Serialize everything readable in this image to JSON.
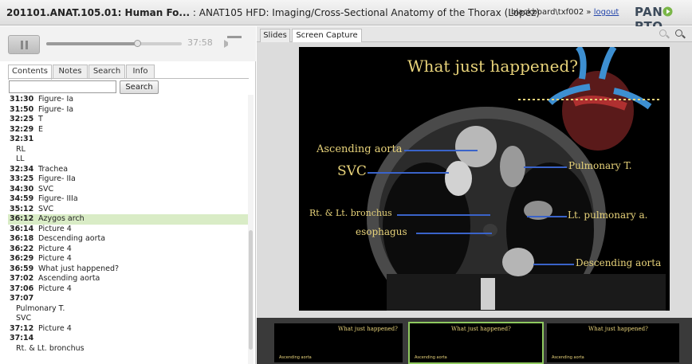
{
  "header": {
    "course_bold": "201101.ANAT.105.01: Human Fo...",
    "course_rest": " : ANAT105 HFD: Imaging/Cross-Sectional Anatomy of the Thorax (Lopez)",
    "user": "blackboard\\txf002 » ",
    "logout": "logout",
    "logo": "PANOPTO"
  },
  "player": {
    "time": "37:58",
    "progress": 0.67
  },
  "left_tabs": [
    "Contents",
    "Notes",
    "Search",
    "Info"
  ],
  "search": {
    "button": "Search",
    "value": ""
  },
  "contents": [
    {
      "time": "31:30",
      "title": "Figure- Ia"
    },
    {
      "time": "31:50",
      "title": "Figure- Ia"
    },
    {
      "time": "32:25",
      "title": "T"
    },
    {
      "time": "32:29",
      "title": "E"
    },
    {
      "time": "32:31",
      "title": "",
      "lines": [
        "RL",
        "LL"
      ]
    },
    {
      "time": "32:34",
      "title": "Trachea"
    },
    {
      "time": "33:25",
      "title": "Figure- IIa"
    },
    {
      "time": "34:30",
      "title": "SVC"
    },
    {
      "time": "34:59",
      "title": "Figure- IIIa"
    },
    {
      "time": "35:12",
      "title": "SVC"
    },
    {
      "time": "36:12",
      "title": "Azygos arch",
      "selected": true
    },
    {
      "time": "36:14",
      "title": "Picture 4"
    },
    {
      "time": "36:18",
      "title": "Descending aorta"
    },
    {
      "time": "36:22",
      "title": "Picture 4"
    },
    {
      "time": "36:29",
      "title": "Picture 4"
    },
    {
      "time": "36:59",
      "title": "What just happened?"
    },
    {
      "time": "37:02",
      "title": "Ascending aorta"
    },
    {
      "time": "37:06",
      "title": "Picture 4"
    },
    {
      "time": "37:07",
      "title": "",
      "lines": [
        "Pulmonary T.",
        "SVC"
      ]
    },
    {
      "time": "37:12",
      "title": "Picture 4"
    },
    {
      "time": "37:14",
      "title": "",
      "lines": [
        "Rt. & Lt. bronchus"
      ]
    }
  ],
  "right_tabs": [
    "Slides",
    "Screen Capture"
  ],
  "slide": {
    "heading": "What just happened?",
    "labels": {
      "ascending_aorta": "Ascending aorta",
      "svc": "SVC",
      "bronchus": "Rt. & Lt. bronchus",
      "esophagus": "esophagus",
      "pulmonary_t": "Pulmonary T.",
      "lt_pulmonary": "Lt. pulmonary a.",
      "descending_aorta": "Descending aorta"
    }
  },
  "thumbnails": [
    {
      "title": "What just happened?",
      "label": "Ascending aorta"
    },
    {
      "title": "What just happened?",
      "label": "Ascending aorta",
      "selected": true
    },
    {
      "title": "What just happened?",
      "label": "Ascending aorta"
    }
  ],
  "colors": {
    "accent_green": "#8fc95f",
    "selected_row": "#d9ecc6",
    "slide_text": "#e8d37a",
    "pointer_line": "#3a63c9"
  }
}
